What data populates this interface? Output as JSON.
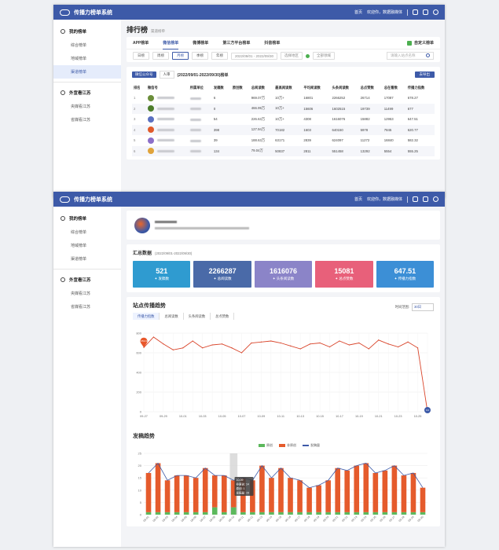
{
  "app": {
    "title": "传播力榜单系统"
  },
  "topbar": {
    "home": "首页",
    "welcome": "欢迎你，数据融媒体"
  },
  "sidebar": {
    "my_lists": "我的榜单",
    "items": [
      "综合榜单",
      "地域榜单",
      "渠道榜单"
    ],
    "external": "外宣看江苏",
    "ext_items": [
      "央媒看江苏",
      "省媒看江苏"
    ]
  },
  "ranking": {
    "title": "排行榜",
    "crumb": "渠道榜单",
    "tabs": [
      "APP榜单",
      "微信榜单",
      "微博榜单",
      "第三方平台榜单",
      "抖音榜单"
    ],
    "custom": "自定义榜单",
    "filters": [
      "日榜",
      "周榜",
      "月榜",
      "季榜",
      "年榜"
    ],
    "date_range": "2022/09/01 - 2022/09/30",
    "region": "选择地区",
    "all_cats": "全部领域",
    "search_placeholder": "请输入站点名称",
    "list_tab1": "微信公众号",
    "list_tab2": "人审",
    "list_title": "(2022/09/01-2022/09/30)榜单",
    "export": "去导出",
    "columns": [
      "排名",
      "微信号",
      "所属单位",
      "发稿数",
      "原创数",
      "总阅读数",
      "最高阅读数",
      "平均阅读数",
      "头条阅读数",
      "总点赞数",
      "总在看数",
      "传播力指数"
    ],
    "rows": [
      {
        "rank": "1",
        "posts": "6",
        "orig": "",
        "total": "969.07万",
        "max": "10万+",
        "avg": "16801",
        "head": "2266252",
        "likes": "26714",
        "looks": "17087",
        "index": "678.27"
      },
      {
        "rank": "2",
        "posts": "0",
        "orig": "",
        "total": "466.99万",
        "max": "10万+",
        "avg": "15606",
        "head": "1602515",
        "likes": "19739",
        "looks": "11499",
        "index": "677"
      },
      {
        "rank": "3",
        "posts": "54",
        "orig": "",
        "total": "226.63万",
        "max": "10万+",
        "avg": "4308",
        "head": "1616076",
        "likes": "15882",
        "looks": "12953",
        "index": "647.51"
      },
      {
        "rank": "4",
        "posts": "",
        "orig": "398",
        "total": "127.94万",
        "max": "70182",
        "avg": "1603",
        "head": "640150",
        "likes": "5978",
        "looks": "7845",
        "index": "620.77"
      },
      {
        "rank": "5",
        "posts": "",
        "orig": "39",
        "total": "188.63万",
        "max": "63171",
        "avg": "2839",
        "head": "624097",
        "likes": "11272",
        "looks": "16840",
        "index": "582.32"
      },
      {
        "rank": "6",
        "posts": "",
        "orig": "134",
        "total": "79.04万",
        "max": "50837",
        "avg": "2811",
        "head": "551458",
        "likes": "13292",
        "looks": "5554",
        "index": "555.25"
      }
    ]
  },
  "detail": {
    "summary_title": "汇总数据",
    "summary_range": "(2022/09/01-2022/09/30)",
    "tiles": [
      {
        "value": "521",
        "label": "发稿数",
        "color": "#2f9bd0"
      },
      {
        "value": "2266287",
        "label": "总阅读数",
        "color": "#4a6aa8"
      },
      {
        "value": "1616076",
        "label": "头条阅读数",
        "color": "#8b84c8"
      },
      {
        "value": "15081",
        "label": "总点赞数",
        "color": "#e8607a"
      },
      {
        "value": "647.51",
        "label": "传播力指数",
        "color": "#3c8fd6"
      }
    ],
    "trend_title": "站点传播趋势",
    "range_label": "时间范围:",
    "range_value": "30日",
    "metric_tabs": [
      "传播力指数",
      "总阅读数",
      "头条阅读数",
      "总点赞数"
    ],
    "dist_title": "发稿趋势",
    "legend": [
      "原创",
      "非原创",
      "发稿量"
    ],
    "tooltip": [
      "10-09",
      "非原创: 14",
      "原创: 1",
      "发稿量: 15"
    ],
    "start_label": "653.9",
    "end_label": "0.0"
  },
  "chart_data": [
    {
      "type": "line",
      "title": "站点传播趋势",
      "x": [
        "09-27",
        "09-28",
        "09-29",
        "09-30",
        "10-01",
        "10-02",
        "10-03",
        "10-04",
        "10-05",
        "10-06",
        "10-07",
        "10-08",
        "10-09",
        "10-10",
        "10-11",
        "10-12",
        "10-13",
        "10-14",
        "10-15",
        "10-16",
        "10-17",
        "10-18",
        "10-19",
        "10-20",
        "10-21",
        "10-22",
        "10-23",
        "10-24",
        "10-25",
        "10-26"
      ],
      "xticks": [
        "09-27",
        "09-29",
        "10-01",
        "10-03",
        "10-05",
        "10-07",
        "10-09",
        "10-11",
        "10-13",
        "10-15",
        "10-17",
        "10-19",
        "10-21",
        "10-23",
        "10-25"
      ],
      "values": [
        653.9,
        760,
        690,
        630,
        650,
        720,
        650,
        680,
        690,
        650,
        600,
        700,
        710,
        720,
        700,
        670,
        640,
        690,
        700,
        660,
        720,
        680,
        700,
        640,
        730,
        690,
        660,
        710,
        650,
        0
      ],
      "ylim": [
        0,
        800
      ],
      "yticks": [
        0,
        200,
        400,
        600,
        800
      ]
    },
    {
      "type": "bar",
      "title": "发稿趋势",
      "categories": [
        "09-01",
        "09-02",
        "09-03",
        "09-04",
        "09-05",
        "09-06",
        "09-07",
        "09-08",
        "09-09",
        "09-10",
        "09-11",
        "09-12",
        "09-13",
        "09-14",
        "09-15",
        "09-16",
        "09-17",
        "09-18",
        "09-19",
        "09-20",
        "09-21",
        "09-22",
        "09-23",
        "09-24",
        "09-25",
        "09-26",
        "09-27",
        "09-28",
        "09-29",
        "09-30"
      ],
      "series": [
        {
          "name": "原创",
          "values": [
            1,
            1,
            1,
            1,
            1,
            1,
            1,
            3,
            1,
            3,
            1,
            1,
            1,
            1,
            1,
            1,
            1,
            1,
            1,
            1,
            1,
            1,
            1,
            1,
            1,
            1,
            1,
            1,
            1,
            1
          ]
        },
        {
          "name": "非原创",
          "values": [
            16,
            20,
            13,
            15,
            15,
            14,
            18,
            13,
            15,
            11,
            14,
            13,
            19,
            14,
            18,
            14,
            13,
            10,
            11,
            13,
            18,
            17,
            19,
            20,
            16,
            17,
            19,
            15,
            16,
            10
          ]
        },
        {
          "name": "发稿量",
          "values": [
            17,
            21,
            14,
            16,
            16,
            15,
            19,
            16,
            16,
            14,
            15,
            14,
            20,
            15,
            19,
            15,
            14,
            11,
            12,
            14,
            19,
            18,
            20,
            21,
            17,
            18,
            20,
            16,
            17,
            11
          ]
        }
      ],
      "ylim": [
        0,
        25
      ],
      "yticks": [
        0,
        5,
        10,
        15,
        20,
        25
      ]
    }
  ]
}
